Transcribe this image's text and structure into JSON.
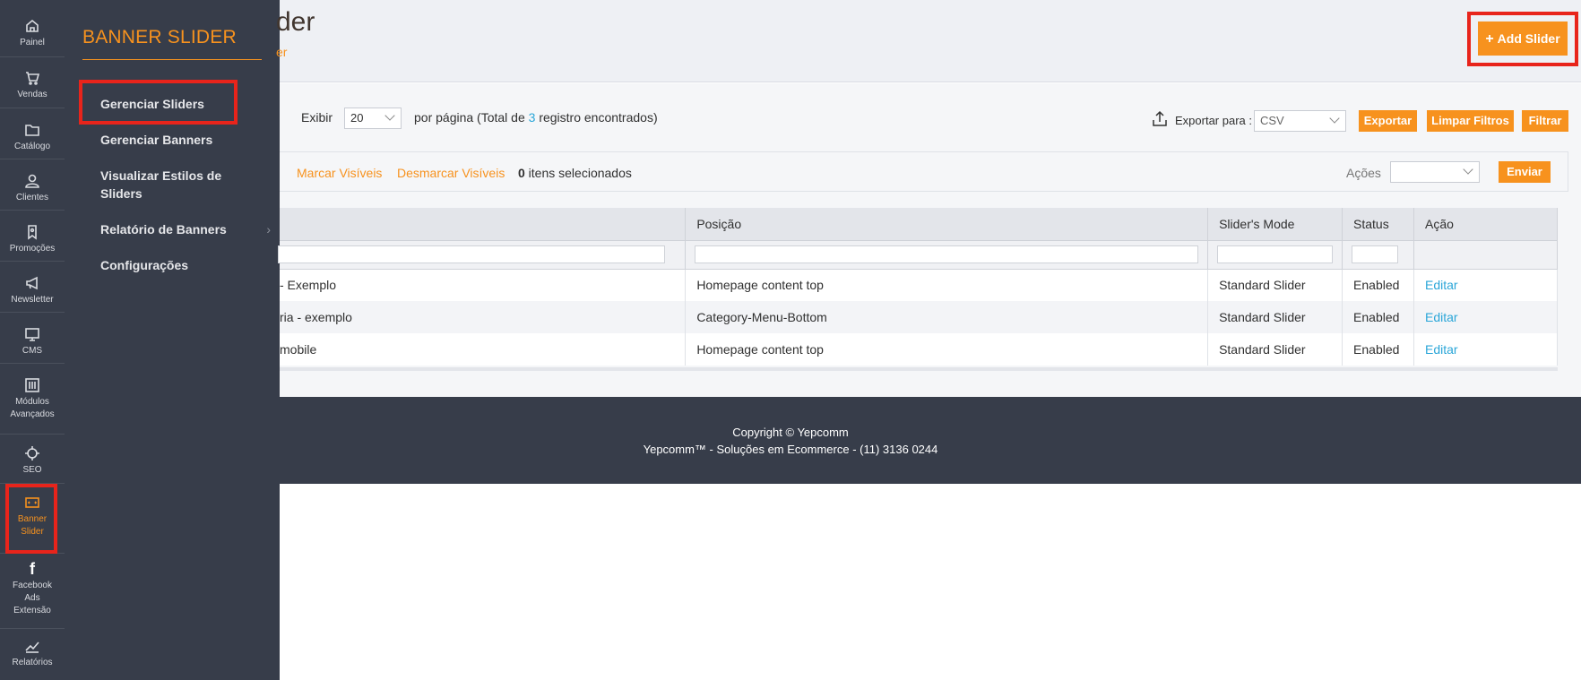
{
  "nav": {
    "items": [
      {
        "label": "Painel",
        "icon": "home-icon"
      },
      {
        "label": "Vendas",
        "icon": "cart-icon"
      },
      {
        "label": "Catálogo",
        "icon": "folder-icon"
      },
      {
        "label": "Clientes",
        "icon": "user-icon"
      },
      {
        "label": "Promoções",
        "icon": "tag-icon"
      },
      {
        "label": "Newsletter",
        "icon": "megaphone-icon"
      },
      {
        "label": "CMS",
        "icon": "monitor-icon"
      },
      {
        "label": "Módulos",
        "label2": "Avançados",
        "icon": "sliders-icon"
      },
      {
        "label": "SEO",
        "icon": "crosshair-icon"
      },
      {
        "label": "Banner",
        "label2": "Slider",
        "icon": "banner-icon"
      },
      {
        "label": "Facebook",
        "label2": "Ads",
        "label3": "Extensão",
        "icon": "facebook-icon"
      },
      {
        "label": "Relatórios",
        "icon": "chart-icon"
      }
    ]
  },
  "flyout": {
    "title": "BANNER SLIDER",
    "items": [
      {
        "label": "Gerenciar Sliders"
      },
      {
        "label": "Gerenciar Banners"
      },
      {
        "label": "Visualizar Estilos de",
        "label2": "Sliders"
      },
      {
        "label": "Relatório de Banners",
        "chevron": "›"
      },
      {
        "label": "Configurações"
      }
    ]
  },
  "header": {
    "title": "der",
    "breadcrumb": "er",
    "add_button": "Add Slider",
    "add_icon": "+"
  },
  "toolbar": {
    "show_label": "Exibir",
    "per_page": "20",
    "per_page_text": "por página (Total de ",
    "total_count": "3",
    "total_suffix": " registro encontrados)",
    "export_label": "Exportar para :",
    "export_format": "CSV",
    "export_button": "Exportar",
    "clear_button": "Limpar Filtros",
    "filter_button": "Filtrar"
  },
  "mass": {
    "mark_visible": "Marcar Visíveis",
    "unmark_visible": "Desmarcar Visíveis",
    "selected_count": "0",
    "selected_text": " itens selecionados",
    "actions_label": "Ações",
    "actions_value": "",
    "send_button": "Enviar"
  },
  "grid": {
    "columns": [
      "",
      "Posição",
      "Slider's Mode",
      "Status",
      "Ação"
    ],
    "rows": [
      {
        "title": "- Exemplo",
        "position": "Homepage content top",
        "mode": "Standard Slider",
        "status": "Enabled",
        "action": "Editar"
      },
      {
        "title": "ria - exemplo",
        "position": "Category-Menu-Bottom",
        "mode": "Standard Slider",
        "status": "Enabled",
        "action": "Editar"
      },
      {
        "title": "mobile",
        "position": "Homepage content top",
        "mode": "Standard Slider",
        "status": "Enabled",
        "action": "Editar"
      }
    ]
  },
  "footer": {
    "copyright": "Copyright © Yepcomm",
    "company": "Yepcomm™ - Soluções em Ecommerce - (11) 3136 0244"
  },
  "colors": {
    "accent": "#f7921e",
    "sidebar": "#373d4a",
    "highlight": "#e8241b",
    "link": "#2aa6d8"
  }
}
